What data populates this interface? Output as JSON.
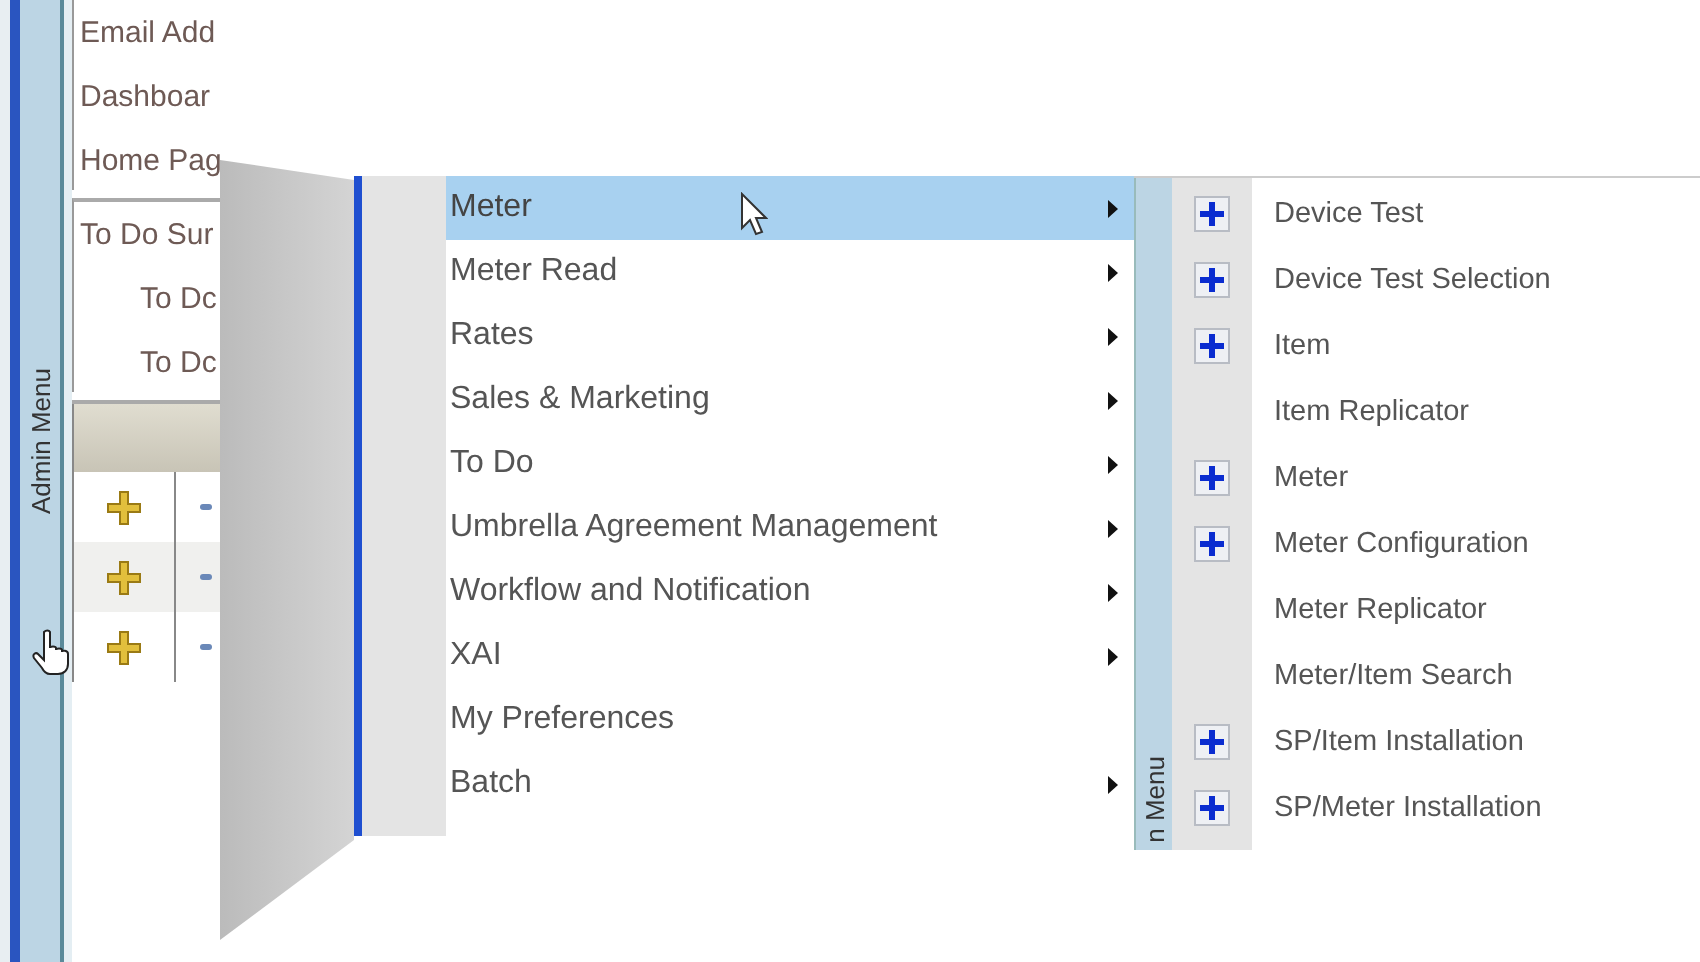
{
  "sidebar_tab": {
    "label": "Admin Menu"
  },
  "left_panel": {
    "links": [
      "Email Add",
      "Dashboar",
      "Home Pag"
    ],
    "todo": [
      {
        "label": "To Do Sur",
        "kind": "heading"
      },
      {
        "label": "To Dc",
        "kind": "sub"
      },
      {
        "label": "To Dc",
        "kind": "sub"
      }
    ],
    "grid_rows": [
      {
        "kind": "add"
      },
      {
        "kind": "add"
      },
      {
        "kind": "add"
      }
    ]
  },
  "menu": {
    "items": [
      {
        "label": "Meter",
        "submenu": true,
        "selected": true
      },
      {
        "label": "Meter Read",
        "submenu": true,
        "selected": false
      },
      {
        "label": "Rates",
        "submenu": true,
        "selected": false
      },
      {
        "label": "Sales & Marketing",
        "submenu": true,
        "selected": false
      },
      {
        "label": "To Do",
        "submenu": true,
        "selected": false
      },
      {
        "label": "Umbrella Agreement Management",
        "submenu": true,
        "selected": false
      },
      {
        "label": "Workflow and Notification",
        "submenu": true,
        "selected": false
      },
      {
        "label": "XAI",
        "submenu": true,
        "selected": false
      },
      {
        "label": "My Preferences",
        "submenu": false,
        "selected": false
      },
      {
        "label": "Batch",
        "submenu": true,
        "selected": false
      }
    ]
  },
  "submenu": {
    "tab_label": "n Menu",
    "items": [
      {
        "label": "Device Test",
        "add": true
      },
      {
        "label": "Device Test Selection",
        "add": true
      },
      {
        "label": "Item",
        "add": true
      },
      {
        "label": "Item Replicator",
        "add": false
      },
      {
        "label": "Meter",
        "add": true
      },
      {
        "label": "Meter Configuration",
        "add": true
      },
      {
        "label": "Meter Replicator",
        "add": false
      },
      {
        "label": "Meter/Item Search",
        "add": false
      },
      {
        "label": "SP/Item Installation",
        "add": true
      },
      {
        "label": "SP/Meter Installation",
        "add": true
      }
    ]
  }
}
